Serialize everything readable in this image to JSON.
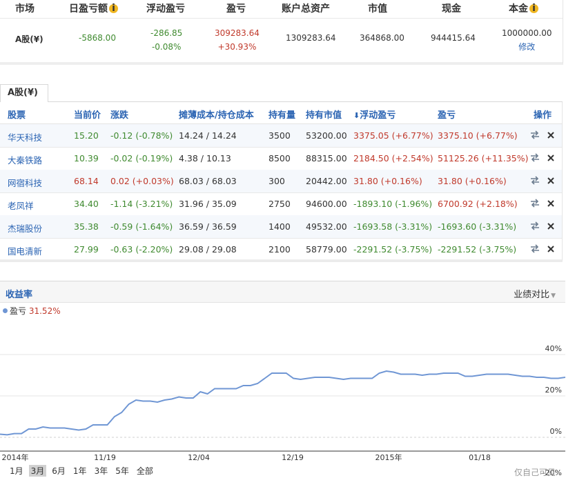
{
  "summary": {
    "headers": {
      "market": "市场",
      "daily_pl": "日盈亏额",
      "floating_pl": "浮动盈亏",
      "pl": "盈亏",
      "total_assets": "账户总资产",
      "market_value": "市值",
      "cash": "现金",
      "principal": "本金"
    },
    "row": {
      "market": "A股(¥)",
      "daily_pl": "-5868.00",
      "floating_pl_value": "-286.85",
      "floating_pl_percent": "-0.08%",
      "pl_value": "309283.64",
      "pl_percent": "+30.93%",
      "total_assets": "1309283.64",
      "market_value": "364868.00",
      "cash": "944415.64",
      "principal": "1000000.00",
      "edit_link": "修改"
    }
  },
  "holdings": {
    "tab_label": "A股(¥)",
    "headers": {
      "stock": "股票",
      "price": "当前价",
      "change": "涨跌",
      "cost": "摊薄成本/持仓成本",
      "shares": "持有量",
      "value": "持有市值",
      "floating_pl": "浮动盈亏",
      "pl": "盈亏",
      "ops": "操作"
    },
    "rows": [
      {
        "name": "华天科技",
        "price": "15.20",
        "change": "-0.12 (-0.78%)",
        "cost": "14.24 / 14.24",
        "shares": "3500",
        "value": "53200.00",
        "floating_pl": "3375.05 (+6.77%)",
        "pl": "3375.10 (+6.77%)"
      },
      {
        "name": "大秦铁路",
        "price": "10.39",
        "change": "-0.02 (-0.19%)",
        "cost": "4.38 / 10.13",
        "shares": "8500",
        "value": "88315.00",
        "floating_pl": "2184.50 (+2.54%)",
        "pl": "51125.26 (+11.35%)"
      },
      {
        "name": "网宿科技",
        "price": "68.14",
        "change": "0.02 (+0.03%)",
        "cost": "68.03 / 68.03",
        "shares": "300",
        "value": "20442.00",
        "floating_pl": "31.80 (+0.16%)",
        "pl": "31.80 (+0.16%)"
      },
      {
        "name": "老凤祥",
        "price": "34.40",
        "change": "-1.14 (-3.21%)",
        "cost": "31.96 / 35.09",
        "shares": "2750",
        "value": "94600.00",
        "floating_pl": "-1893.10 (-1.96%)",
        "pl": "6700.92 (+2.18%)"
      },
      {
        "name": "杰瑞股份",
        "price": "35.38",
        "change": "-0.59 (-1.64%)",
        "cost": "36.59 / 36.59",
        "shares": "1400",
        "value": "49532.00",
        "floating_pl": "-1693.58 (-3.31%)",
        "pl": "-1693.60 (-3.31%)"
      },
      {
        "name": "国电清新",
        "price": "27.99",
        "change": "-0.63 (-2.20%)",
        "cost": "29.08 / 29.08",
        "shares": "2100",
        "value": "58779.00",
        "floating_pl": "-2291.52 (-3.75%)",
        "pl": "-2291.52 (-3.75%)"
      }
    ]
  },
  "chart": {
    "title": "收益率",
    "compare_label": "业绩对比",
    "legend_name": "盈亏",
    "legend_value": "31.52%",
    "ranges": [
      "1月",
      "3月",
      "6月",
      "1年",
      "3年",
      "5年",
      "全部"
    ],
    "active_range": "3月",
    "private_note": "仅自己可见",
    "colors": {
      "line": "#6f96d4"
    }
  },
  "chart_data": {
    "type": "line",
    "x_tick_labels": [
      "2014年",
      "11/19",
      "12/04",
      "12/19",
      "2015年",
      "01/18"
    ],
    "y_tick_labels": [
      "40%",
      "20%",
      "0%",
      "-20%"
    ],
    "ylim": [
      -20,
      40
    ],
    "grid": true,
    "legend_position": "top-left",
    "series": [
      {
        "name": "盈亏",
        "values": [
          1.5,
          1.2,
          1.8,
          1.8,
          4,
          4,
          5,
          4.5,
          4.5,
          4.5,
          4,
          3.5,
          4,
          6,
          6,
          6,
          10,
          12,
          16,
          18,
          17.5,
          17.5,
          17,
          18,
          18.5,
          19.5,
          19,
          19,
          22,
          21,
          23.5,
          23.5,
          23.5,
          23.5,
          25,
          25,
          26,
          28.5,
          31,
          31,
          31,
          28.5,
          28,
          28.5,
          29,
          29,
          29,
          28.5,
          28,
          28.5,
          28.5,
          28.5,
          28.5,
          31,
          32,
          31.5,
          30.5,
          30.5,
          30.5,
          30,
          30.5,
          30.5,
          31,
          31,
          31,
          29.5,
          29.5,
          30,
          30.5,
          30.5,
          30.5,
          30.5,
          30,
          29.5,
          29.5,
          29,
          29,
          28.5,
          28.5,
          29
        ]
      }
    ]
  }
}
